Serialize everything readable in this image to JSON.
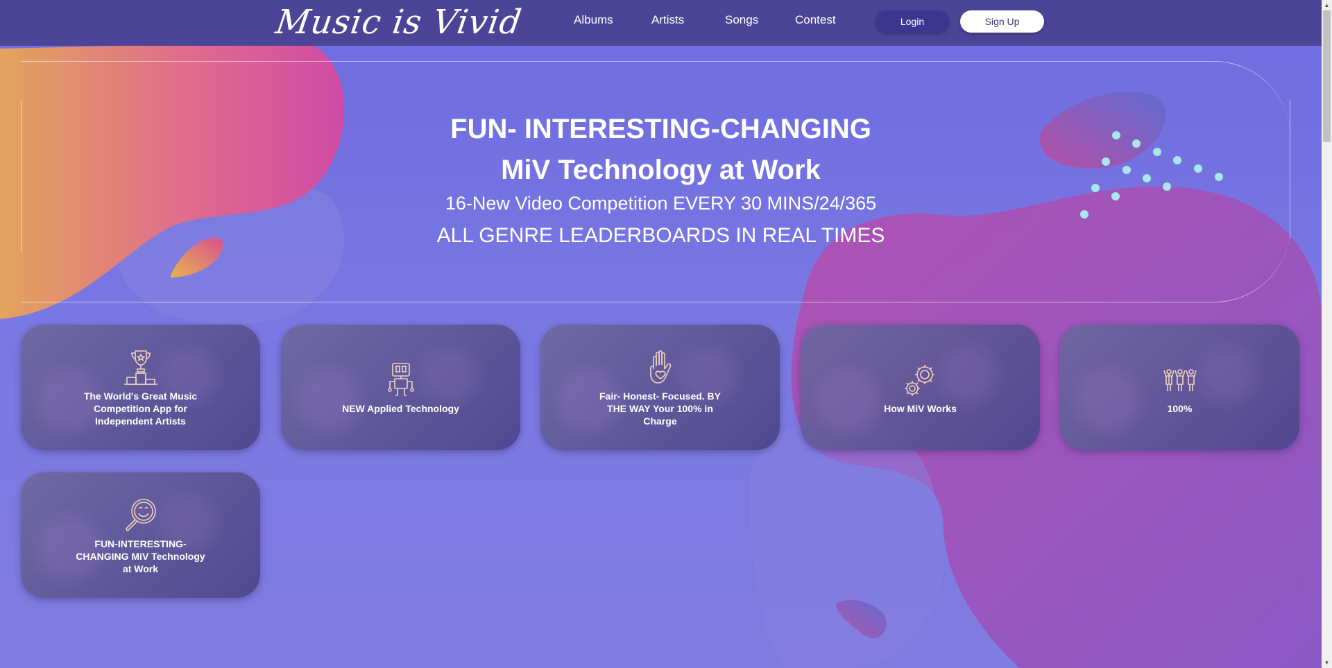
{
  "header": {
    "logo": "Music is Vivid",
    "nav": [
      "Albums",
      "Artists",
      "Songs",
      "Contest"
    ],
    "login_label": "Login",
    "signup_label": "Sign Up"
  },
  "hero": {
    "line1": "FUN- INTERESTING-CHANGING",
    "line2": "MiV Technology at Work",
    "line3": "16-New Video Competition EVERY 30 MINS/24/365",
    "line4": "ALL GENRE LEADERBOARDS IN REAL TIMES"
  },
  "cards": [
    {
      "title": "The World's Great Music Competition App for Independent Artists",
      "icon": "trophy-podium-icon"
    },
    {
      "title": "NEW Applied Technology",
      "icon": "robot-icon"
    },
    {
      "title": "Fair- Honest- Focused. BY THE WAY Your 100% in Charge",
      "icon": "hand-heart-icon"
    },
    {
      "title": "How MiV Works",
      "icon": "gears-icon"
    },
    {
      "title": "100%",
      "icon": "people-cheering-icon"
    },
    {
      "title": "FUN-INTERESTING-CHANGING MiV Technology at Work",
      "icon": "smile-magnifier-icon"
    }
  ],
  "colors": {
    "header_bg": "#4c4597",
    "page_bg": "#7472e0",
    "card_bg": "#5e579e",
    "icon_stroke": "#f3d3bd"
  }
}
